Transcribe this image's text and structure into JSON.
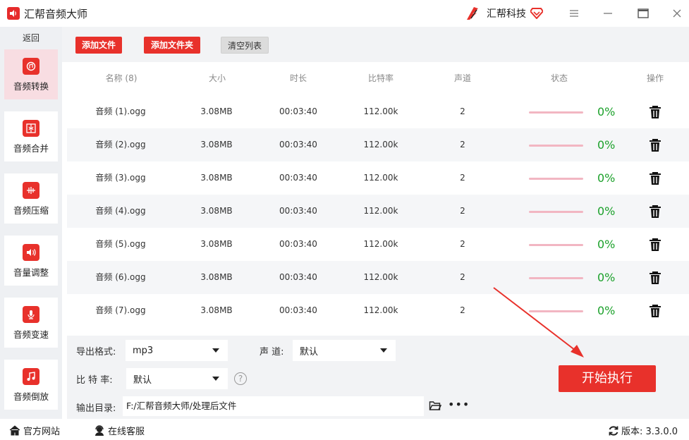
{
  "app": {
    "title": "汇帮音频大师",
    "brand": "汇帮科技"
  },
  "sidebar": {
    "back_label": "返回",
    "items": [
      {
        "label": "音频转换",
        "icon": "audio-convert-icon",
        "active": true
      },
      {
        "label": "音频合并",
        "icon": "audio-merge-icon",
        "active": false
      },
      {
        "label": "音频压缩",
        "icon": "audio-compress-icon",
        "active": false
      },
      {
        "label": "音量调整",
        "icon": "volume-icon",
        "active": false
      },
      {
        "label": "音频变速",
        "icon": "microphone-icon",
        "active": false
      },
      {
        "label": "音频倒放",
        "icon": "music-note-icon",
        "active": false
      }
    ]
  },
  "toolbar": {
    "add_file": "添加文件",
    "add_folder": "添加文件夹",
    "clear_list": "清空列表"
  },
  "table": {
    "headers": [
      "名称 (8)",
      "大小",
      "时长",
      "比特率",
      "声道",
      "状态",
      "操作"
    ],
    "rows": [
      {
        "name": "音频 (1).ogg",
        "size": "3.08MB",
        "duration": "00:03:40",
        "bitrate": "112.00k",
        "channels": "2",
        "progress": 0,
        "progress_text": "0%"
      },
      {
        "name": "音频 (2).ogg",
        "size": "3.08MB",
        "duration": "00:03:40",
        "bitrate": "112.00k",
        "channels": "2",
        "progress": 0,
        "progress_text": "0%"
      },
      {
        "name": "音频 (3).ogg",
        "size": "3.08MB",
        "duration": "00:03:40",
        "bitrate": "112.00k",
        "channels": "2",
        "progress": 0,
        "progress_text": "0%"
      },
      {
        "name": "音频 (4).ogg",
        "size": "3.08MB",
        "duration": "00:03:40",
        "bitrate": "112.00k",
        "channels": "2",
        "progress": 0,
        "progress_text": "0%"
      },
      {
        "name": "音频 (5).ogg",
        "size": "3.08MB",
        "duration": "00:03:40",
        "bitrate": "112.00k",
        "channels": "2",
        "progress": 0,
        "progress_text": "0%"
      },
      {
        "name": "音频 (6).ogg",
        "size": "3.08MB",
        "duration": "00:03:40",
        "bitrate": "112.00k",
        "channels": "2",
        "progress": 0,
        "progress_text": "0%"
      },
      {
        "name": "音频 (7).ogg",
        "size": "3.08MB",
        "duration": "00:03:40",
        "bitrate": "112.00k",
        "channels": "2",
        "progress": 0,
        "progress_text": "0%"
      }
    ]
  },
  "settings": {
    "format_label": "导出格式:",
    "format_value": "mp3",
    "channel_label": "声 道:",
    "channel_value": "默认",
    "bitrate_label": "比 特 率:",
    "bitrate_value": "默认",
    "help_glyph": "?",
    "output_label": "输出目录:",
    "output_value": "F:/汇帮音频大师/处理后文件",
    "more_glyph": "•••",
    "start_label": "开始执行"
  },
  "statusbar": {
    "website": "官方网站",
    "support": "在线客服",
    "version": "版本: 3.3.0.0"
  },
  "colors": {
    "accent": "#e8312b",
    "progress_ok": "#1ca12b",
    "active_bg": "#f8dde2"
  }
}
